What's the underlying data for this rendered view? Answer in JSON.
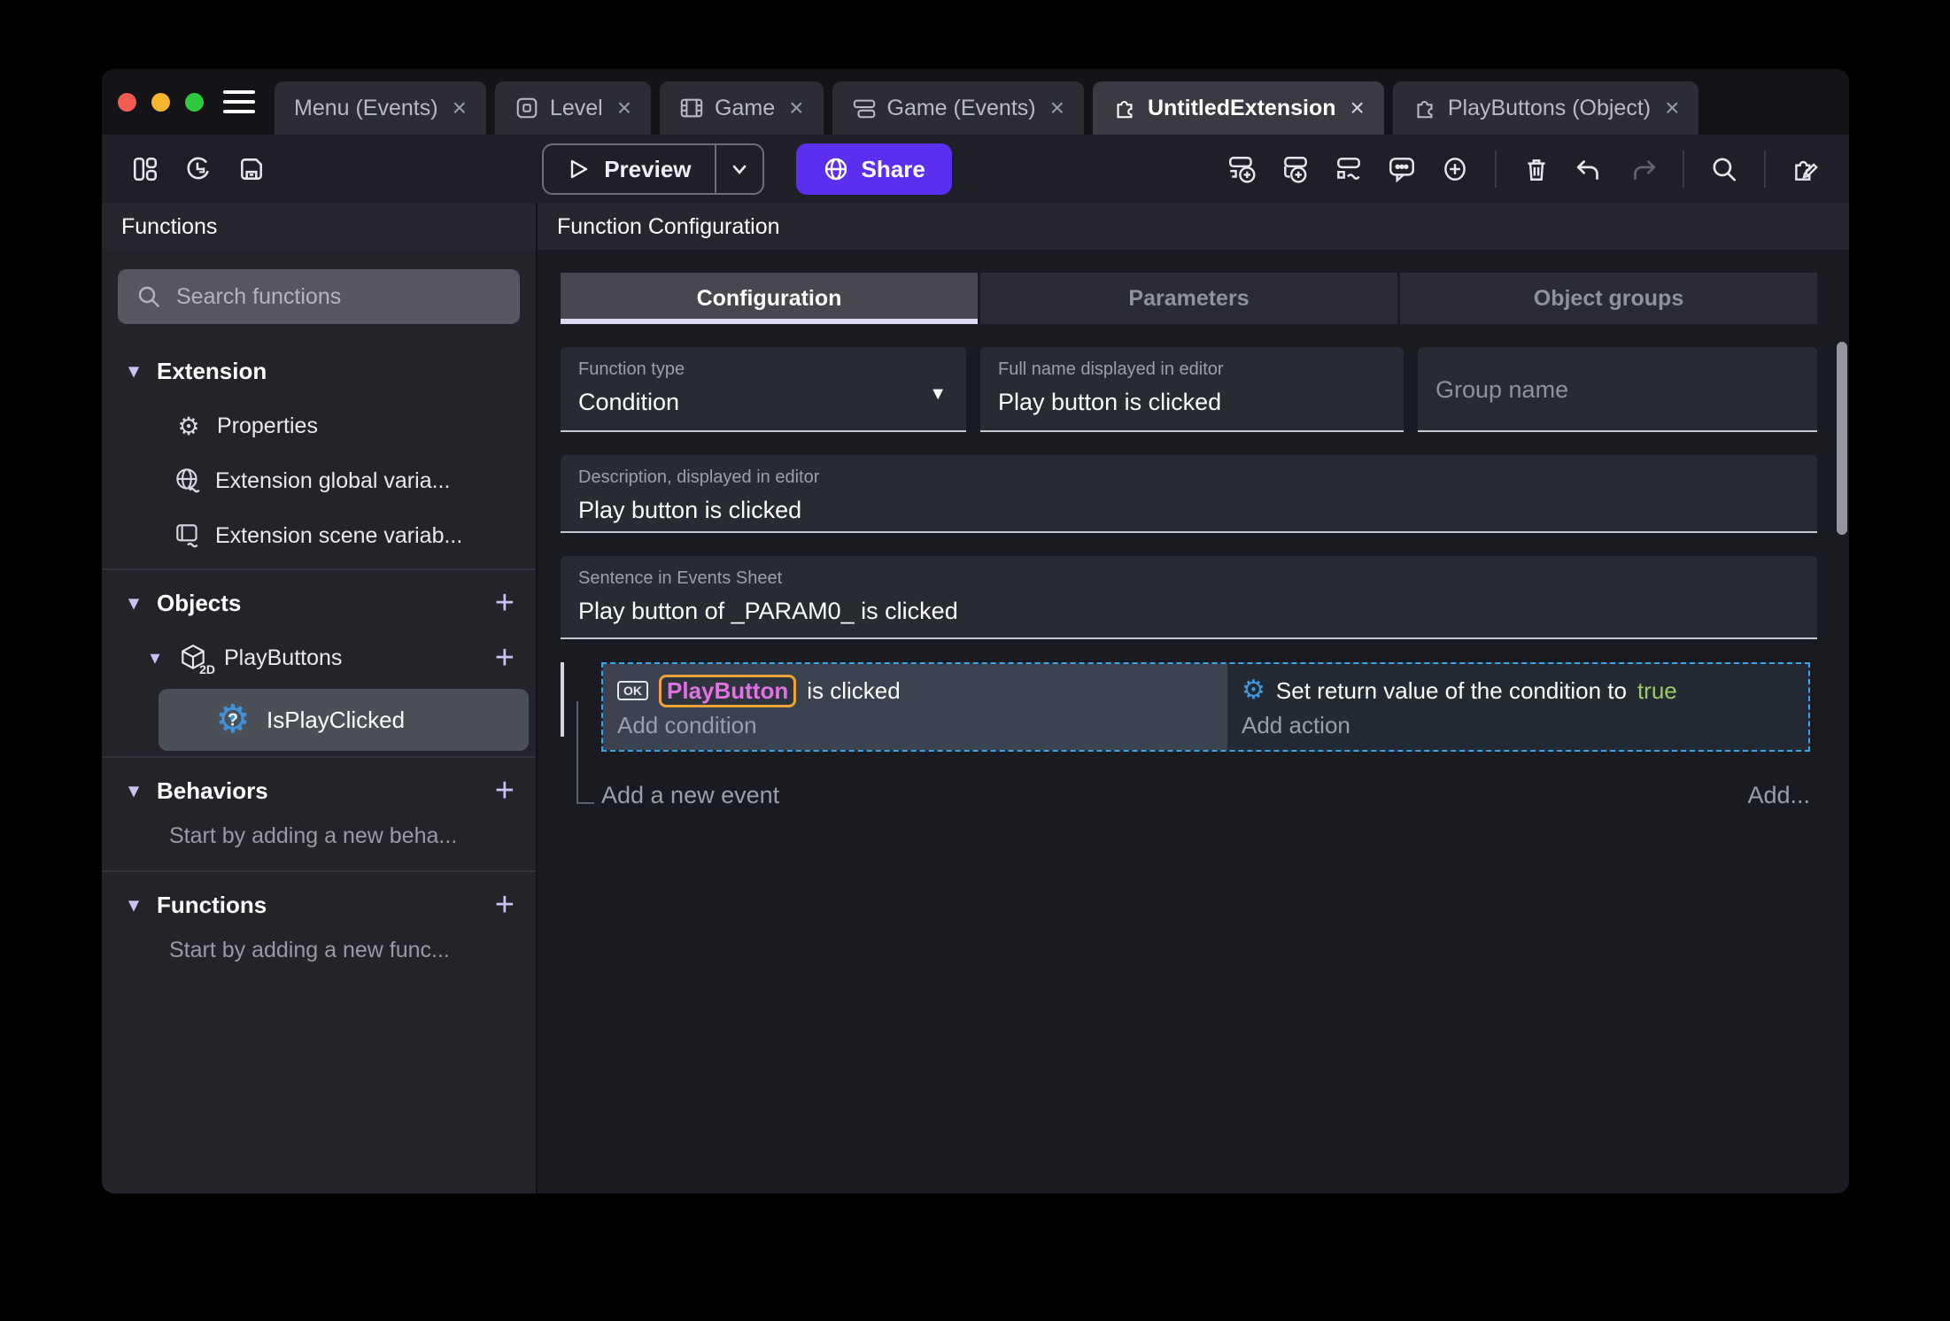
{
  "icons": {
    "close": "×",
    "chevron_down": "▾",
    "dropdown_arrow": "▼",
    "plus": "+",
    "ok_button": "OK",
    "question_mark": "?",
    "two_d": "2D",
    "gear": "⚙"
  },
  "window": {
    "tabs": [
      {
        "label": "Menu (Events)",
        "active": false
      },
      {
        "label": "Level",
        "active": false
      },
      {
        "label": "Game",
        "active": false
      },
      {
        "label": "Game (Events)",
        "active": false
      },
      {
        "label": "UntitledExtension",
        "active": true
      },
      {
        "label": "PlayButtons (Object)",
        "active": false
      }
    ]
  },
  "toolbar": {
    "preview_label": "Preview",
    "share_label": "Share"
  },
  "sidebar": {
    "title": "Functions",
    "search_placeholder": "Search functions",
    "extension": {
      "label": "Extension",
      "items": [
        {
          "label": "Properties"
        },
        {
          "label": "Extension global varia..."
        },
        {
          "label": "Extension scene variab..."
        }
      ]
    },
    "objects": {
      "label": "Objects",
      "object_label": "PlayButtons",
      "function_label": "IsPlayClicked"
    },
    "behaviors": {
      "label": "Behaviors",
      "empty": "Start by adding a new beha..."
    },
    "functions": {
      "label": "Functions",
      "empty": "Start by adding a new func..."
    }
  },
  "main": {
    "title": "Function Configuration",
    "tabs": [
      {
        "label": "Configuration",
        "active": true
      },
      {
        "label": "Parameters",
        "active": false
      },
      {
        "label": "Object groups",
        "active": false
      }
    ],
    "fields": {
      "function_type": {
        "label": "Function type",
        "value": "Condition"
      },
      "full_name": {
        "label": "Full name displayed in editor",
        "value": "Play button is clicked"
      },
      "group_name": {
        "placeholder": "Group name"
      },
      "description": {
        "label": "Description, displayed in editor",
        "value": "Play button is clicked"
      },
      "sentence": {
        "label": "Sentence in Events Sheet",
        "value": "Play button of _PARAM0_ is clicked"
      }
    },
    "events": {
      "condition_object": "PlayButton",
      "condition_text": "is clicked",
      "add_condition": "Add condition",
      "action_text": "Set return value of the condition to",
      "action_value": "true",
      "add_action": "Add action",
      "add_new_event": "Add a new event",
      "add_button": "Add..."
    }
  },
  "colors": {
    "accent_purple": "#5C2EF0",
    "selection_blue": "#38A8EA",
    "true_green": "#9CCC65",
    "object_pink": "#E272E2",
    "param_highlight_orange": "#F0A23A",
    "action_icon_blue": "#3F97E0"
  }
}
